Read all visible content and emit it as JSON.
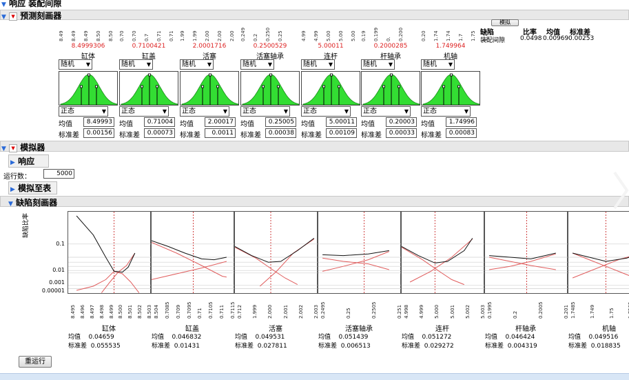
{
  "response_header": "响应 装配间隙",
  "predictor": {
    "title": "预测刻画器",
    "factors": [
      {
        "name": "缸体",
        "value": "8.4999306",
        "ticks": [
          "8.49",
          "8.49",
          "8.49",
          "8.50",
          "8.50"
        ],
        "sampling": "随机",
        "dist": "正态",
        "mean": "8.49993",
        "sd": "0.00156"
      },
      {
        "name": "缸盖",
        "value": "0.7100421",
        "ticks": [
          "0.70",
          "0.70",
          "0.7",
          "0.71",
          "0.71"
        ],
        "sampling": "随机",
        "dist": "正态",
        "mean": "0.71004",
        "sd": "0.00073"
      },
      {
        "name": "活塞",
        "value": "2.0001716",
        "ticks": [
          "1.99",
          "1.99",
          "2.00",
          "2.00",
          "2.00"
        ],
        "sampling": "随机",
        "dist": "正态",
        "mean": "2.00017",
        "sd": "0.0011"
      },
      {
        "name": "活塞轴承",
        "value": "0.2500529",
        "ticks": [
          "0.249",
          "0.2",
          "0.250",
          "0.25"
        ],
        "sampling": "随机",
        "dist": "正态",
        "mean": "0.25005",
        "sd": "0.00038"
      },
      {
        "name": "连杆",
        "value": "5.00011",
        "ticks": [
          "4.99",
          "4.99",
          "5.00",
          "5.00",
          "5.00"
        ],
        "sampling": "随机",
        "dist": "正态",
        "mean": "5.00011",
        "sd": "0.00109"
      },
      {
        "name": "杆轴承",
        "value": "0.2000285",
        "ticks": [
          "0.19",
          "0.199",
          "0.",
          "0.200"
        ],
        "sampling": "随机",
        "dist": "正态",
        "mean": "0.20003",
        "sd": "0.00033"
      },
      {
        "name": "机轴",
        "value": "1.749964",
        "ticks": [
          "0.20",
          "1.74",
          "1.74",
          "1.7",
          "1.75",
          "1.75"
        ],
        "sampling": "随机",
        "dist": "正态",
        "mean": "1.74996",
        "sd": "0.00083"
      }
    ],
    "mean_label": "均值",
    "sd_label": "标准差",
    "top_button": "模拟",
    "defect_table": {
      "headers": [
        "缺陷",
        "比率",
        "均值",
        "标准差"
      ],
      "row": [
        "装配间隙",
        "0.0498",
        "0.00969",
        "0.00253"
      ]
    }
  },
  "simulator": {
    "title": "模拟器",
    "response_label": "响应",
    "runs_label": "运行数：",
    "runs_value": "5000",
    "to_table": "模拟至表"
  },
  "defect_profiler": {
    "title": "缺陷刻画器",
    "ylabel": "缺陷比率",
    "yticks": [
      "0.1",
      "0.01",
      "0.001",
      "0.00001"
    ],
    "panels": [
      {
        "name": "缸体",
        "mean": "0.04659",
        "sd": "0.055535",
        "xticks": [
          "8.495",
          "8.496",
          "8.497",
          "8.498",
          "8.499",
          "8.500",
          "8.501",
          "8.502",
          "8.503"
        ]
      },
      {
        "name": "缸盖",
        "mean": "0.046832",
        "sd": "0.01431",
        "xticks": [
          "8.504",
          "0.7085",
          "0.709",
          "0.7095",
          "0.71",
          "0.7105",
          "0.711",
          "0.7115"
        ]
      },
      {
        "name": "活塞",
        "mean": "0.049531",
        "sd": "0.027811",
        "xticks": [
          "0.712",
          "1.999",
          "2.000",
          "2.001",
          "2.002",
          "2.003"
        ]
      },
      {
        "name": "活塞轴承",
        "mean": "0.051439",
        "sd": "0.006513",
        "xticks": [
          "0.2495",
          "0.25",
          "0.2505",
          "0.251"
        ]
      },
      {
        "name": "连杆",
        "mean": "0.051272",
        "sd": "0.029272",
        "xticks": [
          "4.998",
          "4.999",
          "5.000",
          "5.001",
          "5.002",
          "5.003"
        ]
      },
      {
        "name": "杆轴承",
        "mean": "0.046424",
        "sd": "0.004319",
        "xticks": [
          "0.1995",
          "0.2",
          "0.2005",
          "0.201"
        ]
      },
      {
        "name": "机轴",
        "mean": "0.049516",
        "sd": "0.018835",
        "xticks": [
          "1.7485",
          "1.749",
          "1.75",
          "1.7505",
          "1.751"
        ]
      }
    ],
    "mean_label": "均值",
    "sd_label": "标准差",
    "rerun": "重运行"
  },
  "colors": {
    "accent_red": "#d22222",
    "dist_fill": "#33dd33",
    "curve_black": "#111111",
    "curve_red": "#e05c5c",
    "ref_line": "#d04040"
  }
}
